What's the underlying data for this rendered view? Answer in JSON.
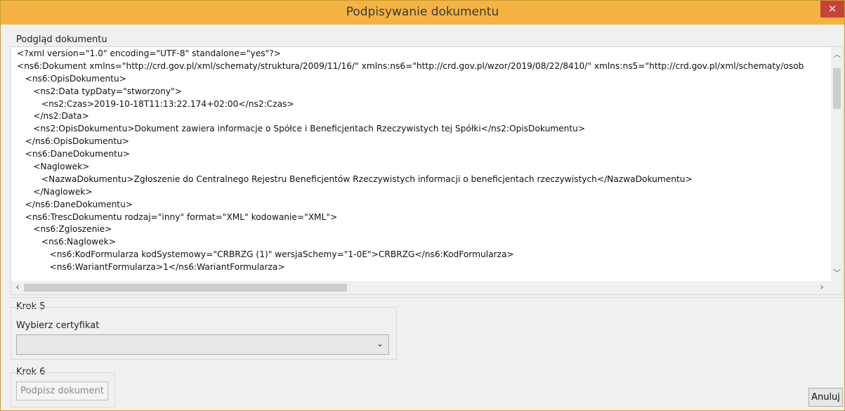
{
  "window": {
    "title": "Podpisywanie dokumentu",
    "close_glyph": "×"
  },
  "preview": {
    "label": "Podgląd dokumentu",
    "lines": [
      "<?xml version=\"1.0\" encoding=\"UTF-8\" standalone=\"yes\"?>",
      "<ns6:Dokument xmlns=\"http://crd.gov.pl/xml/schematy/struktura/2009/11/16/\" xmlns:ns6=\"http://crd.gov.pl/wzor/2019/08/22/8410/\" xmlns:ns5=\"http://crd.gov.pl/xml/schematy/osob",
      "   <ns6:OpisDokumentu>",
      "      <ns2:Data typDaty=\"stworzony\">",
      "         <ns2:Czas>2019-10-18T11:13:22.174+02:00</ns2:Czas>",
      "      </ns2:Data>",
      "      <ns2:OpisDokumentu>Dokument zawiera informacje o Spółce i Beneficjentach Rzeczywistych tej Spółki</ns2:OpisDokumentu>",
      "   </ns6:OpisDokumentu>",
      "   <ns6:DaneDokumentu>",
      "      <Naglowek>",
      "         <NazwaDokumentu>Zgłoszenie do Centralnego Rejestru Beneficjentów Rzeczywistych informacji o beneficjentach rzeczywistych</NazwaDokumentu>",
      "      </Naglowek>",
      "   </ns6:DaneDokumentu>",
      "   <ns6:TrescDokumentu rodzaj=\"inny\" format=\"XML\" kodowanie=\"XML\">",
      "      <ns6:Zgloszenie>",
      "         <ns6:Naglowek>",
      "            <ns6:KodFormularza kodSystemowy=\"CRBRZG (1)\" wersjaSchemy=\"1-0E\">CRBRZG</ns6:KodFormularza>",
      "            <ns6:WariantFormularza>1</ns6:WariantFormularza>"
    ]
  },
  "step5": {
    "label": "Krok 5",
    "select_label": "Wybierz certyfikat",
    "select_value": ""
  },
  "step6": {
    "label": "Krok 6",
    "sign_button": "Podpisz dokument"
  },
  "actions": {
    "cancel_button": "Anuluj"
  },
  "colors": {
    "titlebar": "#f4b342",
    "close": "#c7433a"
  }
}
